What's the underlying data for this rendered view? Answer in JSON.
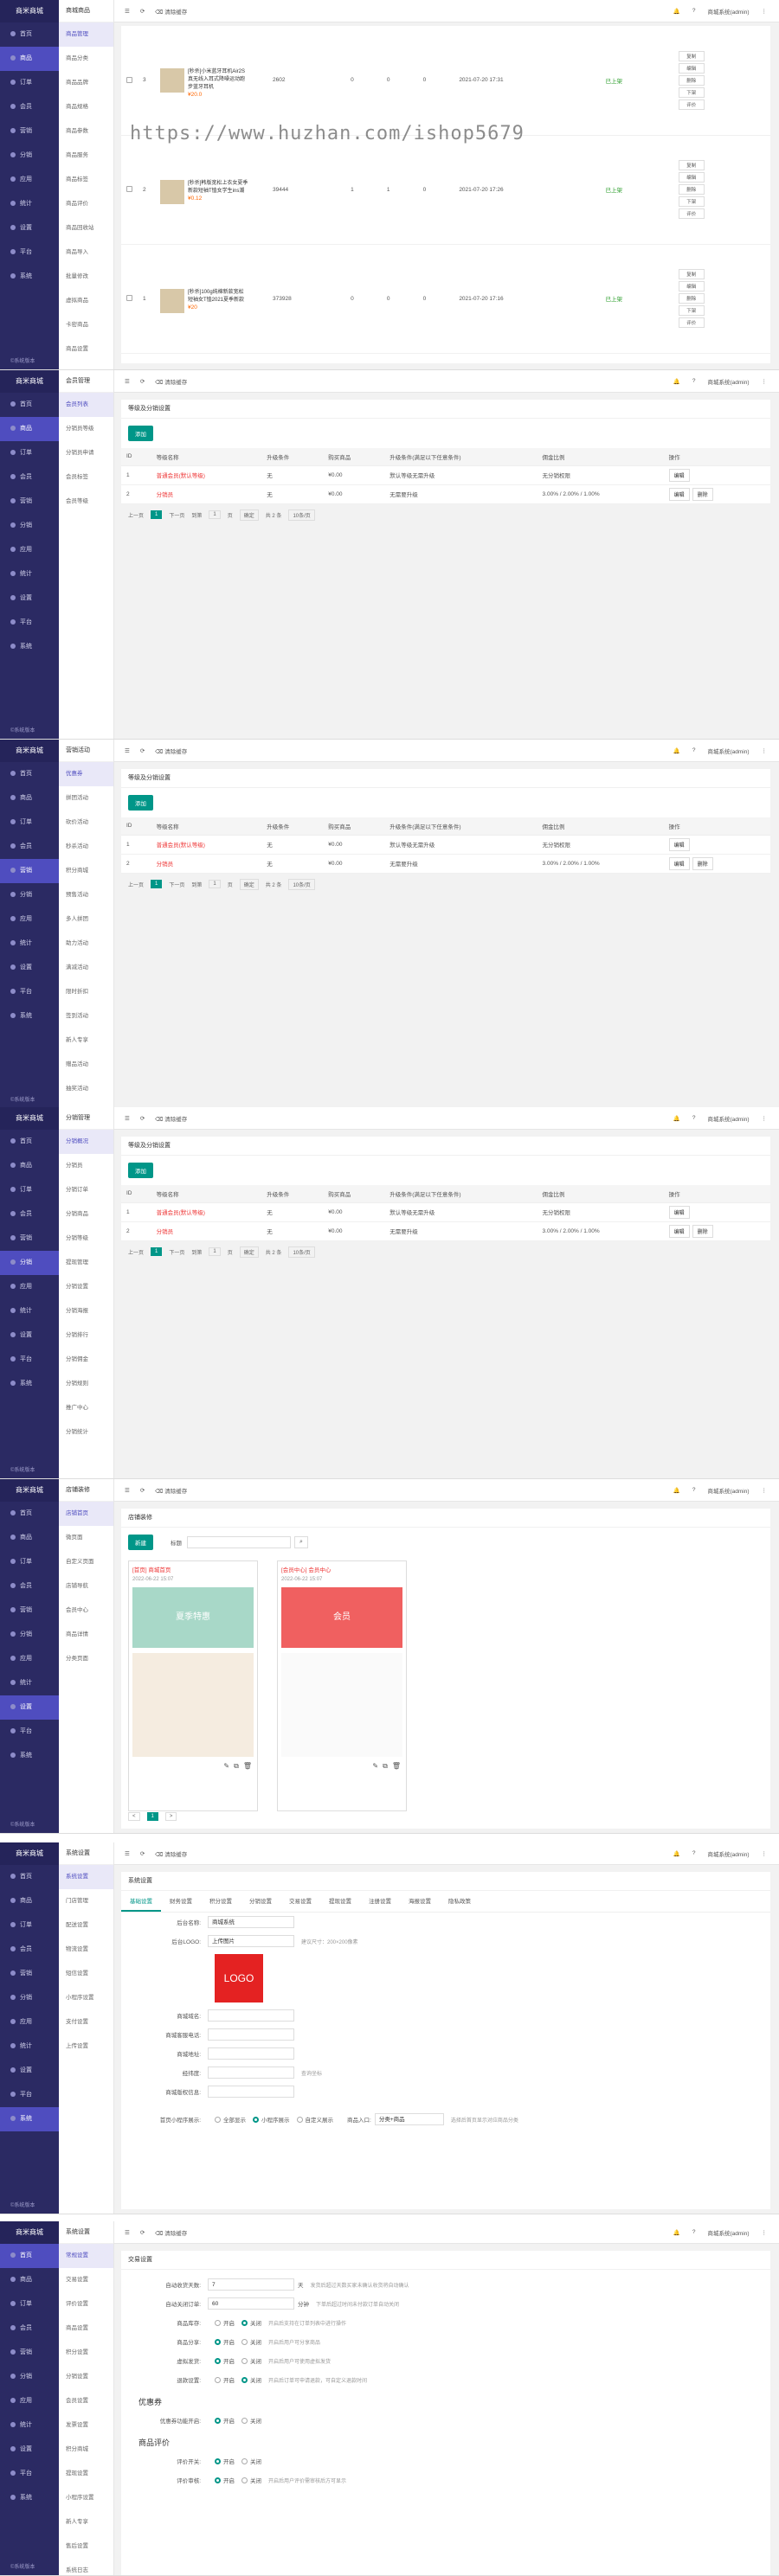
{
  "app": {
    "logo": "商米商城",
    "user": "商城系统(admin)",
    "clear_cache": "清除缓存",
    "refresh_icon": "refresh-icon"
  },
  "rail": [
    "首页",
    "商品",
    "订单",
    "会员",
    "营销",
    "分销",
    "应用",
    "统计",
    "设置",
    "平台",
    "系统"
  ],
  "rail_bottom": "©系统版本",
  "watermark": "https://www.huzhan.com/ishop5679",
  "panel1": {
    "sub_header": "商城商品",
    "sub_items": [
      "商品管理",
      "商品分类",
      "商品品牌",
      "商品规格",
      "商品参数",
      "商品服务",
      "商品标签",
      "商品评价",
      "商品回收站",
      "商品导入",
      "批量修改",
      "虚拟商品",
      "卡密商品",
      "商品设置"
    ],
    "rows": [
      {
        "no": "3",
        "name": "[秒杀]小米蓝牙耳机Air2S真无线入耳式降噪运动跑步蓝牙耳机",
        "price": "¥20.0",
        "stock": "2602",
        "sales": "0",
        "views": "0",
        "sort": "0",
        "time": "2021-07-20 17:31",
        "status": "已上架"
      },
      {
        "no": "2",
        "name": "[秒杀]韩版宽松上衣女夏季新款短袖T恤女学生ins潮",
        "price": "¥0.12",
        "stock": "39444",
        "sales": "1",
        "views": "1",
        "sort": "0",
        "time": "2021-07-20 17:26",
        "status": "已上架"
      },
      {
        "no": "1",
        "name": "[秒杀]100g纯棉新款宽松短袖女T恤2021夏季新款",
        "price": "¥20",
        "stock": "373928",
        "sales": "0",
        "views": "0",
        "sort": "0",
        "time": "2021-07-20 17:16",
        "status": "已上架"
      }
    ],
    "ops": [
      [
        "复制",
        "编辑",
        "删除",
        "下架",
        "评价"
      ],
      [
        "复制",
        "编辑",
        "删除",
        "下架",
        "评价"
      ],
      [
        "复制",
        "编辑",
        "删除",
        "下架",
        "评价"
      ]
    ]
  },
  "level_table": {
    "title": "等级及分销设置",
    "add": "添加",
    "headers": [
      "ID",
      "等级名称",
      "升级条件",
      "购买商品",
      "升级条件(满足以下任意条件)",
      "佣金比例",
      "操作"
    ],
    "rows": [
      {
        "id": "1",
        "name": "普通会员(默认等级)",
        "cond": "无",
        "amount": "¥0.00",
        "rule": "默认等级无需升级",
        "rate": "无分销权限",
        "ops": [
          "编辑"
        ]
      },
      {
        "id": "2",
        "name": "分销员",
        "cond": "无",
        "amount": "¥0.00",
        "rule": "无需要升级",
        "rate": "3.00% / 2.00% / 1.00%",
        "ops": [
          "编辑",
          "删除"
        ]
      }
    ],
    "pager": {
      "prev": "上一页",
      "cur": "1",
      "next": "下一页",
      "to": "到第",
      "page": "页",
      "go": "确定",
      "total": "共 2 条",
      "size": "10条/页"
    }
  },
  "panel2": {
    "sub_header": "会员管理",
    "sub_items": [
      "会员列表",
      "分销员等级",
      "分销员申请",
      "会员标签",
      "会员等级"
    ]
  },
  "panel3": {
    "sub_header": "营销活动",
    "sub_items": [
      "优惠券",
      "拼团活动",
      "砍价活动",
      "秒杀活动",
      "积分商城",
      "预售活动",
      "多人拼团",
      "助力活动",
      "满减活动",
      "限时折扣",
      "签到活动",
      "新人专享",
      "赠品活动",
      "抽奖活动"
    ]
  },
  "panel4": {
    "sub_header": "分销管理",
    "sub_items": [
      "分销概况",
      "分销员",
      "分销订单",
      "分销商品",
      "分销等级",
      "提现管理",
      "分销设置",
      "分销海报",
      "分销排行",
      "分销佣金",
      "分销规则",
      "推广中心",
      "分销统计"
    ]
  },
  "panel5": {
    "sub_header": "店铺装修",
    "sub_items": [
      "店铺首页",
      "微页面",
      "自定义页面",
      "店铺导航",
      "会员中心",
      "商品详情",
      "分类页面"
    ],
    "title": "店铺装修",
    "add": "新建",
    "search_label": "标题",
    "search_icon": "search-icon",
    "pages": [
      {
        "name": "[首页] 商城首页",
        "time": "2022-06-22 15:07",
        "banner": "夏季特惠",
        "ops": [
          "edit-icon",
          "copy-icon",
          "delete-icon"
        ]
      },
      {
        "name": "[会员中心] 会员中心",
        "time": "2022-06-22 15:07",
        "banner": "会员",
        "ops": [
          "edit-icon",
          "copy-icon",
          "delete-icon"
        ]
      }
    ],
    "pager": {
      "prev": "<",
      "cur": "1",
      "next": ">"
    }
  },
  "panel6": {
    "sub_header": "系统设置",
    "sub_items": [
      "系统设置",
      "门店管理",
      "配送设置",
      "物流设置",
      "短信设置",
      "小程序设置",
      "支付设置",
      "上传设置"
    ],
    "title": "系统设置",
    "tabs": [
      "基础设置",
      "财务设置",
      "积分设置",
      "分销设置",
      "交易设置",
      "提现设置",
      "注册设置",
      "海报设置",
      "隐私政策"
    ],
    "fields": [
      {
        "label": "后台名称:",
        "value": "商城系统",
        "hint": ""
      },
      {
        "label": "后台LOGO:",
        "value": "上传图片",
        "hint": "建议尺寸：200×200像素"
      },
      {
        "label": "商城域名:",
        "value": "",
        "hint": ""
      },
      {
        "label": "商城客服电话:",
        "value": "",
        "hint": ""
      },
      {
        "label": "商城地址:",
        "value": "",
        "hint": ""
      },
      {
        "label": "经纬度:",
        "value": "",
        "hint": "查询坐标"
      },
      {
        "label": "商城版权信息:",
        "value": "",
        "hint": ""
      }
    ],
    "logo_text": "LOGO",
    "radio_label": "首页小程序展示:",
    "radio_options": [
      "全部显示",
      "小程序展示",
      "自定义展示"
    ],
    "select_label": "商品入口:",
    "select_value": "分类+商品",
    "select_hint": "选择后首页显示对应商品分类"
  },
  "panel7": {
    "sub_header": "系统设置",
    "sub_items": [
      "常规设置",
      "交易设置",
      "评价设置",
      "商品设置",
      "积分设置",
      "分销设置",
      "会员设置",
      "发票设置",
      "积分商城",
      "提现设置",
      "小程序设置",
      "新人专享",
      "售后设置",
      "系统日志"
    ],
    "title": "交易设置",
    "rows": [
      {
        "label": "自动收货天数:",
        "value": "7",
        "unit": "天",
        "hint": "发货后超过天数买家未确认收货将自动确认"
      },
      {
        "label": "自动关闭订单:",
        "value": "60",
        "unit": "分钟",
        "hint": "下单后超过时间未付款订单自动关闭"
      },
      {
        "label": "商品库存:",
        "opts": [
          "开启",
          "关闭"
        ],
        "on": 1,
        "hint": "开启后支持在订单列表中进行操作"
      },
      {
        "label": "商品分享:",
        "opts": [
          "开启",
          "关闭"
        ],
        "on": 0,
        "hint": "开启后用户可分享商品"
      },
      {
        "label": "虚拟发货:",
        "opts": [
          "开启",
          "关闭"
        ],
        "on": 0,
        "hint": "开启后用户可使用虚拟发货"
      },
      {
        "label": "退款设置:",
        "opts": [
          "开启",
          "关闭"
        ],
        "on": 1,
        "hint": "开启后订单可申请退款，可自定义退款时间"
      }
    ],
    "coupon_title": "优惠券",
    "coupon_row": {
      "label": "优惠券功能开启:",
      "opts": [
        "开启",
        "关闭"
      ],
      "on": 0
    },
    "review_title": "商品评价",
    "review_rows": [
      {
        "label": "评价开关:",
        "opts": [
          "开启",
          "关闭"
        ],
        "on": 0
      },
      {
        "label": "评价审核:",
        "opts": [
          "开启",
          "关闭"
        ],
        "on": 0,
        "hint": "开启后用户评价需审核后方可显示"
      }
    ]
  }
}
